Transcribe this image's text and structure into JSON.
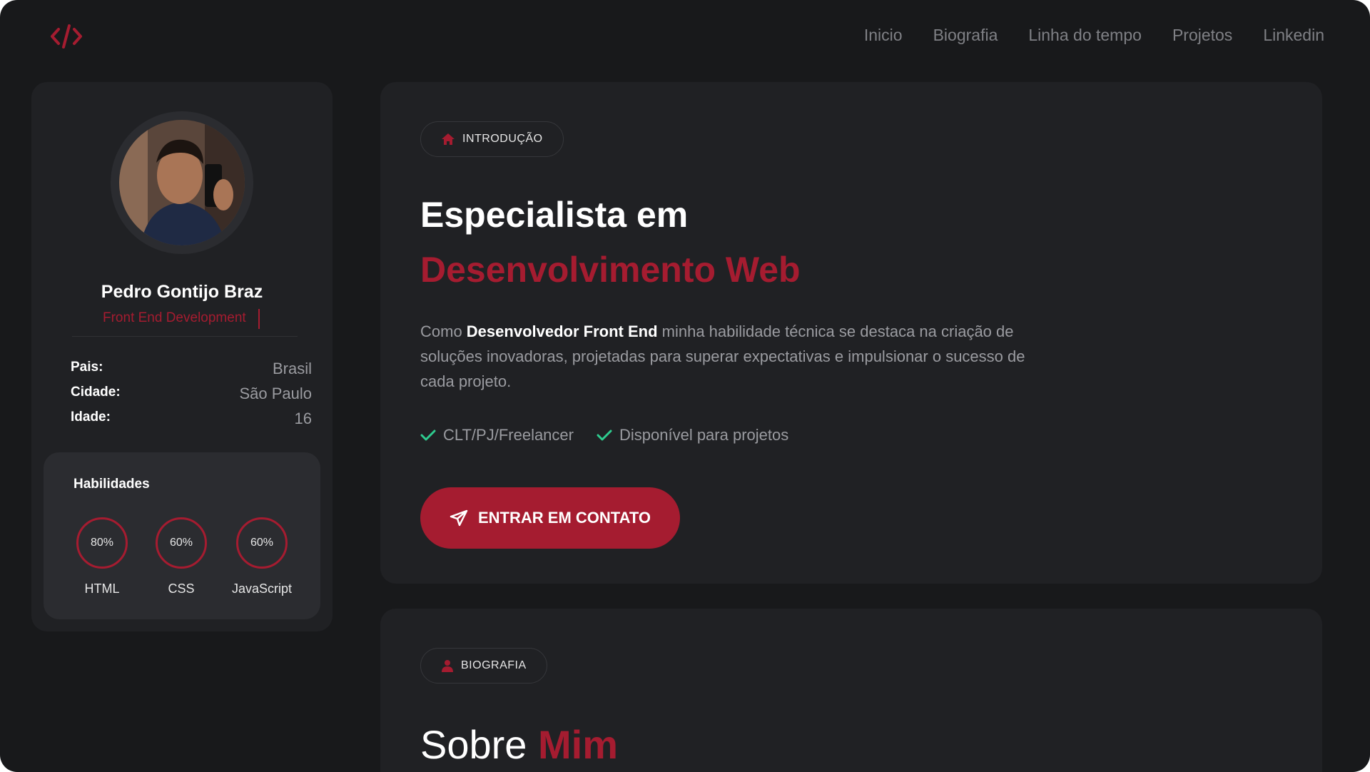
{
  "nav": {
    "items": [
      "Inicio",
      "Biografia",
      "Linha do tempo",
      "Projetos",
      "Linkedin"
    ]
  },
  "profile": {
    "name": "Pedro Gontijo Braz",
    "role": "Front End Development",
    "info": [
      {
        "key": "Pais:",
        "value": "Brasil"
      },
      {
        "key": "Cidade:",
        "value": "São Paulo"
      },
      {
        "key": "Idade:",
        "value": "16"
      }
    ]
  },
  "skills": {
    "title": "Habilidades",
    "items": [
      {
        "percent": "80%",
        "name": "HTML"
      },
      {
        "percent": "60%",
        "name": "CSS"
      },
      {
        "percent": "60%",
        "name": "JavaScript"
      }
    ]
  },
  "intro": {
    "badge": "INTRODUÇÃO",
    "title_line1": "Especialista em",
    "title_line2": "Desenvolvimento Web",
    "para_pre": "Como ",
    "para_bold": "Desenvolvedor Front End",
    "para_post": " minha habilidade técnica se destaca na criação de soluções inovadoras, projetadas para superar expectativas e impulsionar o sucesso de cada projeto.",
    "checks": [
      "CLT/PJ/Freelancer",
      "Disponível para projetos"
    ],
    "cta": "ENTRAR EM CONTATO"
  },
  "bio": {
    "badge": "BIOGRAFIA",
    "title_plain": "Sobre ",
    "title_accent": "Mim"
  },
  "colors": {
    "accent": "#a51c30",
    "background": "#18191b",
    "card": "#202124",
    "check": "#2ecc8f"
  }
}
